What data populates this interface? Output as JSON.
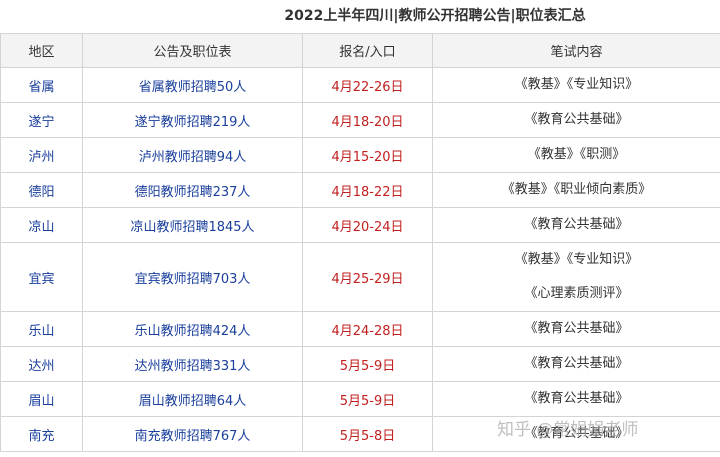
{
  "title": "2022上半年四川|教师公开招聘公告|职位表汇总",
  "headers": {
    "region": "地区",
    "notice": "公告及职位表",
    "period": "报名/入口",
    "exam": "笔试内容"
  },
  "rows": [
    {
      "region": "省属",
      "notice": "省属教师招聘50人",
      "period": "4月22-26日",
      "exam": [
        "《教基》《专业知识》"
      ]
    },
    {
      "region": "遂宁",
      "notice": "遂宁教师招聘219人",
      "period": "4月18-20日",
      "exam": [
        "《教育公共基础》"
      ]
    },
    {
      "region": "泸州",
      "notice": "泸州教师招聘94人",
      "period": "4月15-20日",
      "exam": [
        "《教基》《职测》"
      ]
    },
    {
      "region": "德阳",
      "notice": "德阳教师招聘237人",
      "period": "4月18-22日",
      "exam": [
        "《教基》《职业倾向素质》"
      ]
    },
    {
      "region": "凉山",
      "notice": "凉山教师招聘1845人",
      "period": "4月20-24日",
      "exam": [
        "《教育公共基础》"
      ]
    },
    {
      "region": "宜宾",
      "notice": "宜宾教师招聘703人",
      "period": "4月25-29日",
      "exam": [
        "《教基》《专业知识》",
        "《心理素质测评》"
      ]
    },
    {
      "region": "乐山",
      "notice": "乐山教师招聘424人",
      "period": "4月24-28日",
      "exam": [
        "《教育公共基础》"
      ]
    },
    {
      "region": "达州",
      "notice": "达州教师招聘331人",
      "period": "5月5-9日",
      "exam": [
        "《教育公共基础》"
      ]
    },
    {
      "region": "眉山",
      "notice": "眉山教师招聘64人",
      "period": "5月5-9日",
      "exam": [
        "《教育公共基础》"
      ]
    },
    {
      "region": "南充",
      "notice": "南充教师招聘767人",
      "period": "5月5-8日",
      "exam": [
        "《教育公共基础》"
      ]
    }
  ],
  "watermark": "知乎 @常娟娟老师"
}
